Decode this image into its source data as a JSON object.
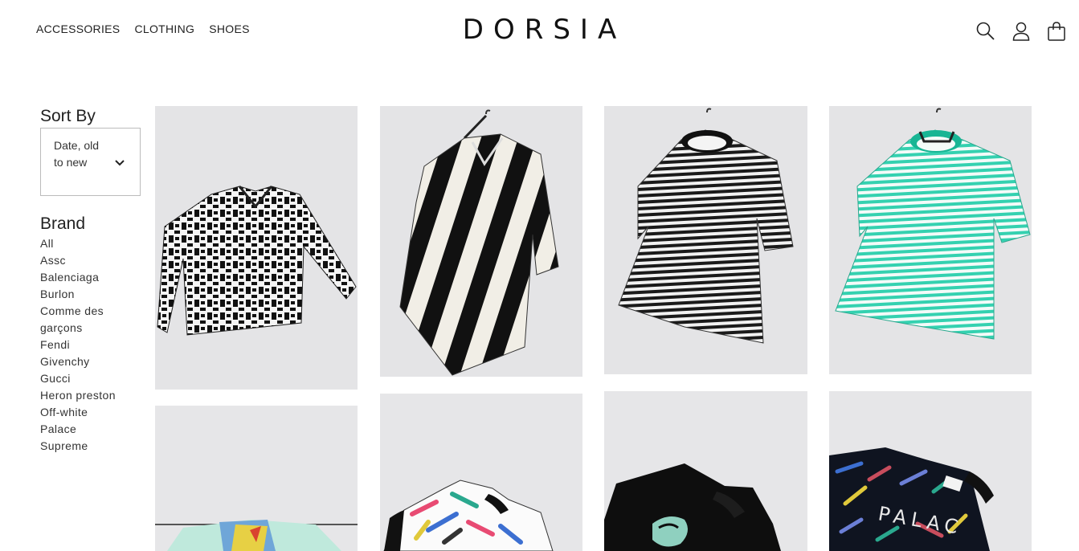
{
  "header": {
    "nav": [
      "ACCESSORIES",
      "CLOTHING",
      "SHOES"
    ],
    "logo": "DORSIA",
    "icons": [
      "search-icon",
      "account-icon",
      "bag-icon"
    ]
  },
  "sidebar": {
    "sort_title": "Sort By",
    "sort_value": "Date, old to new",
    "brand_title": "Brand",
    "brands": [
      "All",
      "Assc",
      "Balenciaga",
      "Burlon",
      "Comme des garçons",
      "Fendi",
      "Givenchy",
      "Gucci",
      "Heron preston",
      "Off-white",
      "Palace",
      "Supreme"
    ]
  },
  "products": [
    {
      "name": "patterned-jacket",
      "image": "black-white-print-jacket"
    },
    {
      "name": "striped-shirt",
      "image": "black-white-stripe-shirt"
    },
    {
      "name": "black-striped-tee",
      "image": "black-white-stripe-tee"
    },
    {
      "name": "teal-striped-tee",
      "image": "teal-white-stripe-tee"
    },
    {
      "name": "mint-graphic-tee",
      "image": "mint-tee-on-rail"
    },
    {
      "name": "brush-print-tee",
      "image": "white-brush-print-tee"
    },
    {
      "name": "black-graphic-tee",
      "image": "black-tee-teal-graphic"
    },
    {
      "name": "palace-print-tee",
      "image": "black-palace-brush-tee"
    }
  ],
  "product_labels": {
    "palace_print": "PALAC"
  },
  "colors": {
    "accent_teal": "#34d1b0",
    "background": "#ffffff",
    "photo_bg": "#e4e4e6"
  }
}
